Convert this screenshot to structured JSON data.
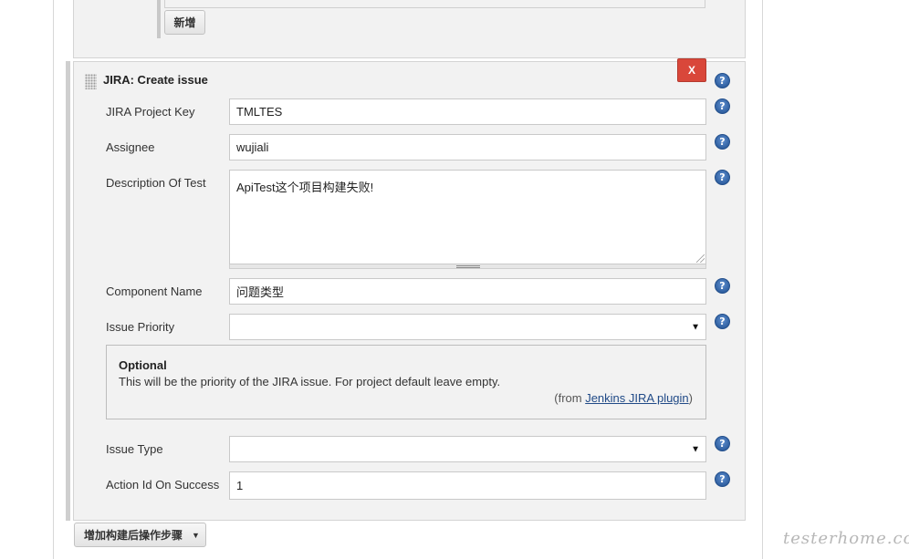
{
  "previous_section": {
    "add_button_label": "新增"
  },
  "issue_section": {
    "title": "JIRA: Create issue",
    "delete_label": "X",
    "help_glyph": "?",
    "fields": {
      "project_key": {
        "label": "JIRA Project Key",
        "value": "TMLTES"
      },
      "assignee": {
        "label": "Assignee",
        "value": "wujiali"
      },
      "description": {
        "label": "Description Of Test",
        "value": "ApiTest这个项目构建失败!"
      },
      "component": {
        "label": "Component Name",
        "value": "问题类型"
      },
      "priority": {
        "label": "Issue Priority",
        "value": ""
      },
      "issue_type": {
        "label": "Issue Type",
        "value": ""
      },
      "action_id": {
        "label": "Action Id On Success",
        "value": "1"
      }
    },
    "priority_help": {
      "title": "Optional",
      "text": "This will be the priority of the JIRA issue. For project default leave empty.",
      "from_prefix": "(from ",
      "link_text": "Jenkins JIRA plugin",
      "from_suffix": ")"
    }
  },
  "footer": {
    "add_step_label": "增加构建后操作步骤"
  },
  "watermark": "testerhome.com",
  "icons": {
    "help": "help-icon",
    "dropdown": "dropdown-arrow-icon",
    "drag": "drag-handle-icon"
  },
  "colors": {
    "delete_button": "#d9473a",
    "help_icon": "#2e5e9f",
    "link": "#204a87"
  }
}
